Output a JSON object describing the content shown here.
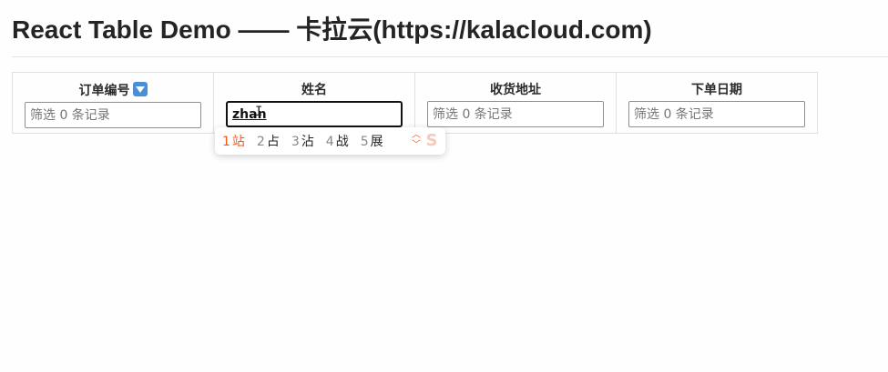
{
  "title": "React Table Demo —— 卡拉云(https://kalacloud.com)",
  "columns": [
    {
      "label": "订单编号",
      "has_sort_icon": true,
      "filter_placeholder": "筛选 0 条记录",
      "filter_value": ""
    },
    {
      "label": "姓名",
      "has_sort_icon": false,
      "filter_placeholder": "筛选 0 条记录",
      "filter_value": "zhan"
    },
    {
      "label": "收货地址",
      "has_sort_icon": false,
      "filter_placeholder": "筛选 0 条记录",
      "filter_value": ""
    },
    {
      "label": "下单日期",
      "has_sort_icon": false,
      "filter_placeholder": "筛选 0 条记录",
      "filter_value": ""
    }
  ],
  "ime": {
    "candidates": [
      {
        "num": "1",
        "text": "站"
      },
      {
        "num": "2",
        "text": "占"
      },
      {
        "num": "3",
        "text": "沾"
      },
      {
        "num": "4",
        "text": "战"
      },
      {
        "num": "5",
        "text": "展"
      }
    ],
    "selected_index": 0,
    "accent_color": "#ef5b25",
    "logo_icon": "sogou-ime-logo-icon",
    "page_icon": "page-up-down-icon"
  },
  "colors": {
    "title": "#242424",
    "border": "#e0e0e0",
    "sort_icon": "#4a8fd6"
  }
}
